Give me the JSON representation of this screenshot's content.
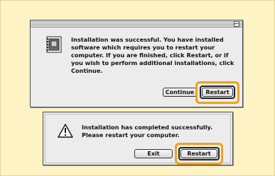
{
  "dialog1": {
    "message": "Installation was successful. You have installed software which requires you to restart your computer. If you are finished, click Restart, or if you wish to perform additional installations, click Continue.",
    "continue_label": "Continue",
    "restart_label": "Restart",
    "icon": "installer-icon"
  },
  "dialog2": {
    "message_line1": "Installation has completed successfully.",
    "message_line2": "Please restart your computer.",
    "exit_label": "Exit",
    "restart_label": "Restart",
    "icon": "caution-icon"
  },
  "colors": {
    "background": "#fdf3c4",
    "highlight": "#f2a01e",
    "dialog": "#ececec"
  }
}
